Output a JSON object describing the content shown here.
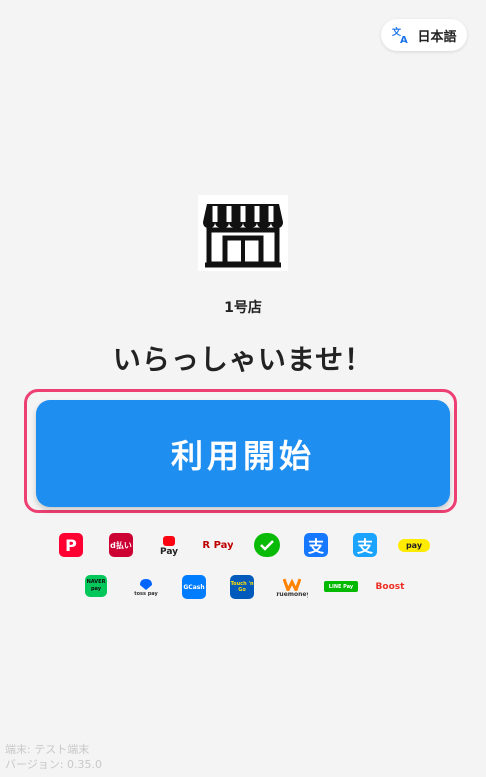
{
  "header": {
    "language_label": "日本語"
  },
  "store": {
    "name": "1号店",
    "greeting": "いらっしゃいませ！"
  },
  "main": {
    "start_label": "利用開始"
  },
  "payments": {
    "row1": [
      {
        "name": "paypay-icon",
        "text": "P",
        "color": "#ff0033"
      },
      {
        "name": "d-barai-icon",
        "text": "d払い",
        "color": "#cc0033"
      },
      {
        "name": "merpay-icon",
        "text": "Pay",
        "color": "#ff0211"
      },
      {
        "name": "rakuten-pay-icon",
        "text": "R Pay",
        "color": "#bf0000"
      },
      {
        "name": "wechat-pay-icon",
        "text": "",
        "color": "#09bb07"
      },
      {
        "name": "alipay-icon",
        "text": "支",
        "color": "#1677ff"
      },
      {
        "name": "alipay-plus-icon",
        "text": "支",
        "color": "#1aa3ff"
      },
      {
        "name": "kakaopay-icon",
        "text": "pay",
        "color": "#ffeb00"
      }
    ],
    "row2": [
      {
        "name": "naver-pay-icon",
        "text": "NAVER pay",
        "color": "#03c75a"
      },
      {
        "name": "toss-pay-icon",
        "text": "toss pay",
        "color": "#0064ff"
      },
      {
        "name": "gcash-icon",
        "text": "GCash",
        "color": "#007cff"
      },
      {
        "name": "touch-n-go-icon",
        "text": "Touch 'n Go",
        "color": "#005abb"
      },
      {
        "name": "truemoney-icon",
        "text": "truemoney",
        "color": "#ff8300"
      },
      {
        "name": "line-pay-icon",
        "text": "LINE Pay",
        "color": "#00b900"
      },
      {
        "name": "boost-icon",
        "text": "Boost",
        "color": "#ee2e24"
      }
    ]
  },
  "footer": {
    "terminal": "端末: テスト端末",
    "version": "バージョン: 0.35.0"
  }
}
